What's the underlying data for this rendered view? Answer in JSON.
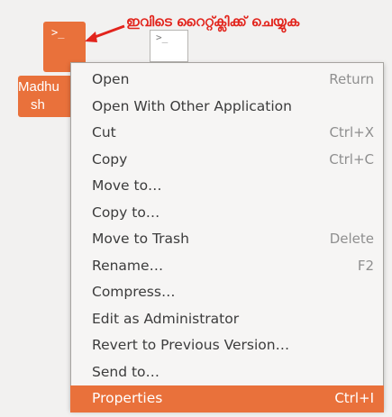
{
  "desktop": {
    "file_icon_glyph": ">_",
    "file_label_line1": "Madhu",
    "file_label_line2": "sh",
    "second_icon_glyph": ">_"
  },
  "annotation": {
    "text": "ഇവിടെ റൈറ്റ്ക്ലിക്ക് ചെയ്യുക",
    "color": "#e2241c"
  },
  "context_menu": {
    "items": [
      {
        "label": "Open",
        "shortcut": "Return"
      },
      {
        "label": "Open With Other Application",
        "shortcut": ""
      },
      {
        "label": "Cut",
        "shortcut": "Ctrl+X"
      },
      {
        "label": "Copy",
        "shortcut": "Ctrl+C"
      },
      {
        "label": "Move to…",
        "shortcut": ""
      },
      {
        "label": "Copy to…",
        "shortcut": ""
      },
      {
        "label": "Move to Trash",
        "shortcut": "Delete"
      },
      {
        "label": "Rename…",
        "shortcut": "F2"
      },
      {
        "label": "Compress…",
        "shortcut": ""
      },
      {
        "label": "Edit as Administrator",
        "shortcut": ""
      },
      {
        "label": "Revert to Previous Version…",
        "shortcut": ""
      },
      {
        "label": "Send to…",
        "shortcut": ""
      },
      {
        "label": "Properties",
        "shortcut": "Ctrl+I"
      }
    ],
    "selected_index": 12,
    "accent_color": "#e9713b"
  }
}
